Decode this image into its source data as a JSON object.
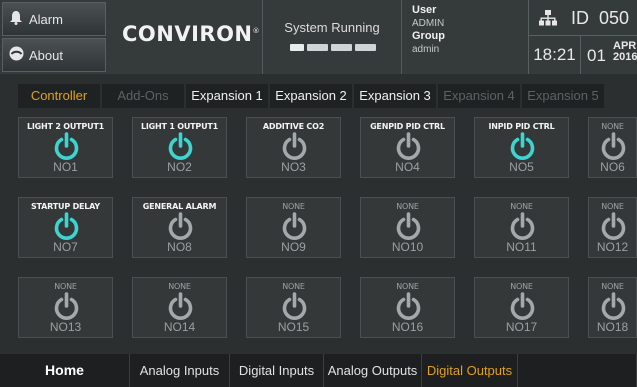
{
  "header": {
    "alarm_label": "Alarm",
    "about_label": "About",
    "logo": "CONVIRON",
    "logo_mark": "®",
    "status_text": "System Running",
    "user_label": "User",
    "user_value": "ADMIN",
    "group_label": "Group",
    "group_value": "admin",
    "id_label": "ID",
    "id_value": "050",
    "time": "18:21",
    "day": "01",
    "month": "APR",
    "year": "2016"
  },
  "tabs": [
    {
      "label": "Controller",
      "state": "active"
    },
    {
      "label": "Add-Ons",
      "state": "disabled"
    },
    {
      "label": "Expansion 1",
      "state": "normal"
    },
    {
      "label": "Expansion 2",
      "state": "normal"
    },
    {
      "label": "Expansion 3",
      "state": "normal"
    },
    {
      "label": "Expansion 4",
      "state": "disabled"
    },
    {
      "label": "Expansion 5",
      "state": "disabled"
    }
  ],
  "outputs": [
    {
      "label": "LIGHT 2 OUTPUT1",
      "code": "NO1",
      "on": true
    },
    {
      "label": "LIGHT 1 OUTPUT1",
      "code": "NO2",
      "on": true
    },
    {
      "label": "ADDITIVE CO2",
      "code": "NO3",
      "on": false
    },
    {
      "label": "GENPID PID CTRL",
      "code": "NO4",
      "on": false
    },
    {
      "label": "INPID PID CTRL",
      "code": "NO5",
      "on": true
    },
    {
      "label": "NONE",
      "code": "NO6",
      "on": false
    },
    {
      "label": "STARTUP DELAY",
      "code": "NO7",
      "on": true
    },
    {
      "label": "GENERAL ALARM",
      "code": "NO8",
      "on": false
    },
    {
      "label": "NONE",
      "code": "NO9",
      "on": false
    },
    {
      "label": "NONE",
      "code": "NO10",
      "on": false
    },
    {
      "label": "NONE",
      "code": "NO11",
      "on": false
    },
    {
      "label": "NONE",
      "code": "NO12",
      "on": false
    },
    {
      "label": "NONE",
      "code": "NO13",
      "on": false
    },
    {
      "label": "NONE",
      "code": "NO14",
      "on": false
    },
    {
      "label": "NONE",
      "code": "NO15",
      "on": false
    },
    {
      "label": "NONE",
      "code": "NO16",
      "on": false
    },
    {
      "label": "NONE",
      "code": "NO17",
      "on": false
    },
    {
      "label": "NONE",
      "code": "NO18",
      "on": false
    }
  ],
  "nav": [
    {
      "label": "Home",
      "state": "home"
    },
    {
      "label": "Analog Inputs",
      "state": "normal"
    },
    {
      "label": "Digital Inputs",
      "state": "normal"
    },
    {
      "label": "Analog Outputs",
      "state": "normal"
    },
    {
      "label": "Digital Outputs",
      "state": "active"
    },
    {
      "label": "",
      "state": "normal"
    }
  ],
  "colors": {
    "power_on": "#3fd4d0",
    "power_off": "#a3a8aa",
    "active_accent": "#e0a020"
  },
  "icons": {
    "alarm": "bell-icon",
    "about": "info-icon",
    "network": "network-icon",
    "power": "power-icon"
  }
}
